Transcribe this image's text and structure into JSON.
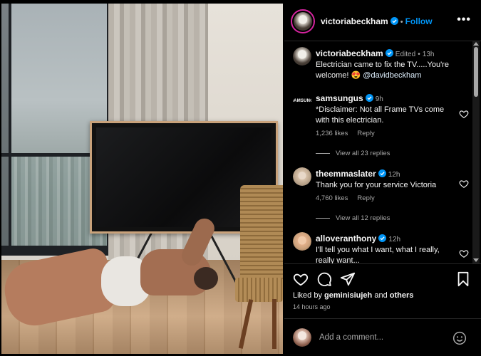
{
  "post": {
    "author": "victoriabeckham",
    "follow_label": "Follow",
    "more_label": "•••",
    "dot": "•"
  },
  "caption": {
    "author": "victoriabeckham",
    "edited": "Edited",
    "dot": "•",
    "time": "13h",
    "text": "Electrician came to fix the TV.....You're welcome! 😍 ",
    "mention": "@davidbeckham"
  },
  "comments": [
    {
      "author": "samsungus",
      "time": "9h",
      "text": "*Disclaimer: Not all Frame TVs come with this electrician.",
      "likes": "1,236 likes",
      "reply_label": "Reply",
      "view_replies": "View all 23 replies",
      "avatar_text": "SAMSUNG"
    },
    {
      "author": "theemmaslater",
      "time": "12h",
      "text": "Thank you for your service Victoria",
      "likes": "4,760 likes",
      "reply_label": "Reply",
      "view_replies": "View all 12 replies"
    },
    {
      "author": "alloveranthony",
      "time": "12h",
      "text": "I'll tell you what I want, what I really, really want..."
    }
  ],
  "liked_by": {
    "prefix": "Liked by ",
    "user": "geminisiujeh",
    "mid": " and ",
    "others": "others"
  },
  "timestamp": "14 hours ago",
  "add_comment": {
    "placeholder": "Add a comment..."
  },
  "colors": {
    "follow": "#0095f6",
    "verified": "#0095f6",
    "background": "#000000",
    "secondary_text": "#a8a8a8"
  },
  "icons": [
    "heart-icon",
    "comment-icon",
    "share-icon",
    "bookmark-icon",
    "emoji-icon",
    "verified-icon",
    "more-icon"
  ]
}
